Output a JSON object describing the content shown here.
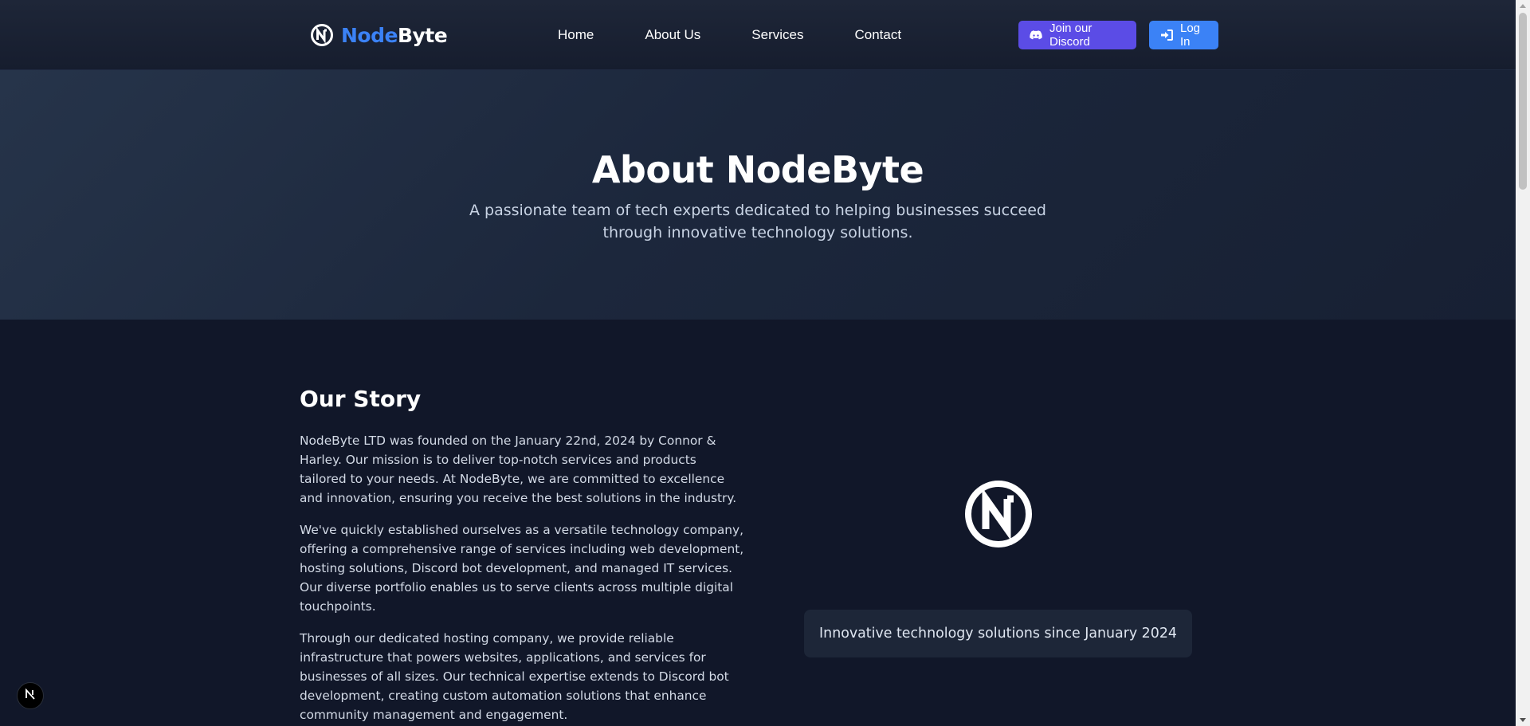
{
  "header": {
    "logo": {
      "part1": "Node",
      "part2": "Byte",
      "icon": "nodebyte-logo-icon"
    },
    "nav": [
      "Home",
      "About Us",
      "Services",
      "Contact"
    ],
    "discord_button": {
      "label": "Join our Discord",
      "icon": "discord-icon"
    },
    "login_button": {
      "label": "Log In",
      "icon": "sign-in-icon"
    }
  },
  "hero": {
    "title": "About NodeByte",
    "subtitle": "A passionate team of tech experts dedicated to helping businesses succeed through innovative technology solutions."
  },
  "story": {
    "title": "Our Story",
    "paragraphs": [
      "NodeByte LTD was founded on the January 22nd, 2024 by Connor & Harley. Our mission is to deliver top-notch services and products tailored to your needs. At NodeByte, we are committed to excellence and innovation, ensuring you receive the best solutions in the industry.",
      "We've quickly established ourselves as a versatile technology company, offering a comprehensive range of services including web development, hosting solutions, Discord bot development, and managed IT services. Our diverse portfolio enables us to serve clients across multiple digital touchpoints.",
      "Through our dedicated hosting company, we provide reliable infrastructure that powers websites, applications, and services for businesses of all sizes. Our technical expertise extends to Discord bot development, creating custom automation solutions that enhance community management and engagement."
    ],
    "tagline": "Innovative technology solutions since January 2024"
  },
  "colors": {
    "accent_blue": "#3b82f6",
    "discord_purple": "#5b4ce6",
    "background": "#111729",
    "hero_background": "#1f2a40"
  }
}
